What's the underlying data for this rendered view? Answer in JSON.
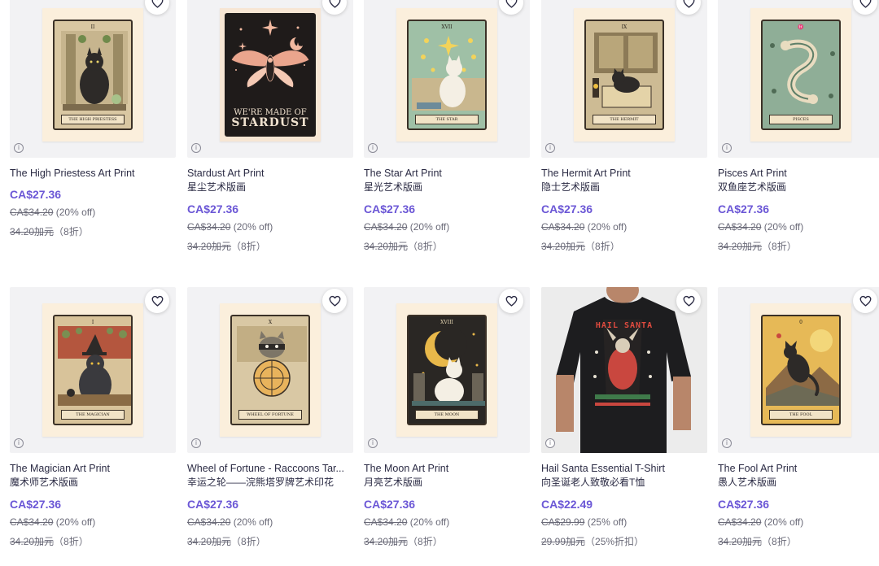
{
  "products": [
    {
      "title": "The High Priestess Art Print",
      "subtitle": "",
      "price": "CA$27.36",
      "original": "CA$34.20",
      "discount": "(20% off)",
      "original_cn": "34.20加元",
      "discount_cn": "（8折）",
      "numeral": "II",
      "banner": "THE HIGH PRIESTESS",
      "art": "high-priestess"
    },
    {
      "title": "Stardust Art Print",
      "subtitle": "星尘艺术版画",
      "price": "CA$27.36",
      "original": "CA$34.20",
      "discount": "(20% off)",
      "original_cn": "34.20加元",
      "discount_cn": "（8折）",
      "art_text_1": "WE'RE MADE OF",
      "art_text_2": "STARDUST",
      "art": "stardust"
    },
    {
      "title": "The Star Art Print",
      "subtitle": "星光艺术版画",
      "price": "CA$27.36",
      "original": "CA$34.20",
      "discount": "(20% off)",
      "original_cn": "34.20加元",
      "discount_cn": "（8折）",
      "numeral": "XVII",
      "banner": "THE STAR",
      "art": "star"
    },
    {
      "title": "The Hermit Art Print",
      "subtitle": "隐士艺术版画",
      "price": "CA$27.36",
      "original": "CA$34.20",
      "discount": "(20% off)",
      "original_cn": "34.20加元",
      "discount_cn": "（8折）",
      "numeral": "IX",
      "banner": "THE HERMIT",
      "art": "hermit"
    },
    {
      "title": "Pisces Art Print",
      "subtitle": "双鱼座艺术版画",
      "price": "CA$27.36",
      "original": "CA$34.20",
      "discount": "(20% off)",
      "original_cn": "34.20加元",
      "discount_cn": "（8折）",
      "numeral": "♓",
      "banner": "PISCES",
      "art": "pisces"
    },
    {
      "title": "The Magician Art Print",
      "subtitle": "魔术师艺术版画",
      "price": "CA$27.36",
      "original": "CA$34.20",
      "discount": "(20% off)",
      "original_cn": "34.20加元",
      "discount_cn": "（8折）",
      "numeral": "I",
      "banner": "THE MAGICIAN",
      "art": "magician"
    },
    {
      "title": "Wheel of Fortune - Raccoons Tar...",
      "subtitle": "幸运之轮——浣熊塔罗牌艺术印花",
      "price": "CA$27.36",
      "original": "CA$34.20",
      "discount": "(20% off)",
      "original_cn": "34.20加元",
      "discount_cn": "（8折）",
      "numeral": "X",
      "banner": "WHEEL OF FORTUNE",
      "art": "wheel"
    },
    {
      "title": "The Moon Art Print",
      "subtitle": "月亮艺术版画",
      "price": "CA$27.36",
      "original": "CA$34.20",
      "discount": "(20% off)",
      "original_cn": "34.20加元",
      "discount_cn": "（8折）",
      "numeral": "XVIII",
      "banner": "THE MOON",
      "art": "moon"
    },
    {
      "title": "Hail Santa Essential T-Shirt",
      "subtitle": "向圣诞老人致敬必看T恤",
      "price": "CA$22.49",
      "original": "CA$29.99",
      "discount": "(25% off)",
      "original_cn": "29.99加元",
      "discount_cn": "（25%折扣）",
      "art_text_1": "HAIL SANTA",
      "art": "shirt"
    },
    {
      "title": "The Fool Art Print",
      "subtitle": "愚人艺术版画",
      "price": "CA$27.36",
      "original": "CA$34.20",
      "discount": "(20% off)",
      "original_cn": "34.20加元",
      "discount_cn": "（8折）",
      "numeral": "0",
      "banner": "THE FOOL",
      "art": "fool"
    }
  ],
  "icons": {
    "favorite": "heart-outline-icon",
    "info": "info-icon"
  },
  "colors": {
    "price": "#6b57d6",
    "card_bg": "#f2f2f4",
    "mat": "#fbefdc"
  }
}
